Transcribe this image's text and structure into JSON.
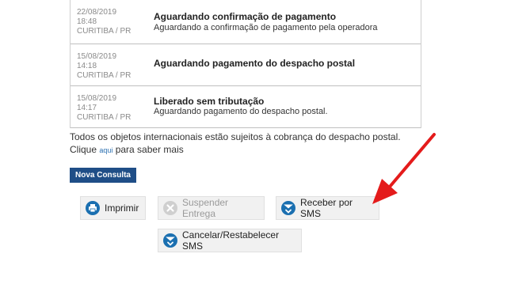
{
  "events": [
    {
      "date": "22/08/2019",
      "time": "18:48",
      "location": "CURITIBA / PR",
      "title": "Aguardando confirmação de pagamento",
      "description": "Aguardando a confirmação de pagamento pela operadora"
    },
    {
      "date": "15/08/2019",
      "time": "14:18",
      "location": "CURITIBA / PR",
      "title": "Aguardando pagamento do despacho postal",
      "description": ""
    },
    {
      "date": "15/08/2019",
      "time": "14:17",
      "location": "CURITIBA / PR",
      "title": "Liberado sem tributação",
      "description": "Aguardando pagamento do despacho postal."
    }
  ],
  "notice": {
    "line1": "Todos os objetos internacionais estão sujeitos à cobrança do despacho postal.",
    "pre_link": "Clique ",
    "link": "aqui",
    "post_link": " para saber mais"
  },
  "nova_consulta": "Nova Consulta",
  "buttons": {
    "imprimir": "Imprimir",
    "suspender": "Suspender Entrega",
    "receber_sms": "Receber por SMS",
    "cancelar_sms": "Cancelar/Restabelecer SMS"
  },
  "icons": {
    "imprimir": "printer-icon",
    "suspender": "cancel-circle-icon",
    "receber_sms": "sms-icon",
    "cancelar_sms": "sms-icon"
  },
  "colors": {
    "primary_button": "#1f4e87",
    "icon_blue": "#1a6fb0",
    "annotation_arrow": "#e41b1b"
  }
}
